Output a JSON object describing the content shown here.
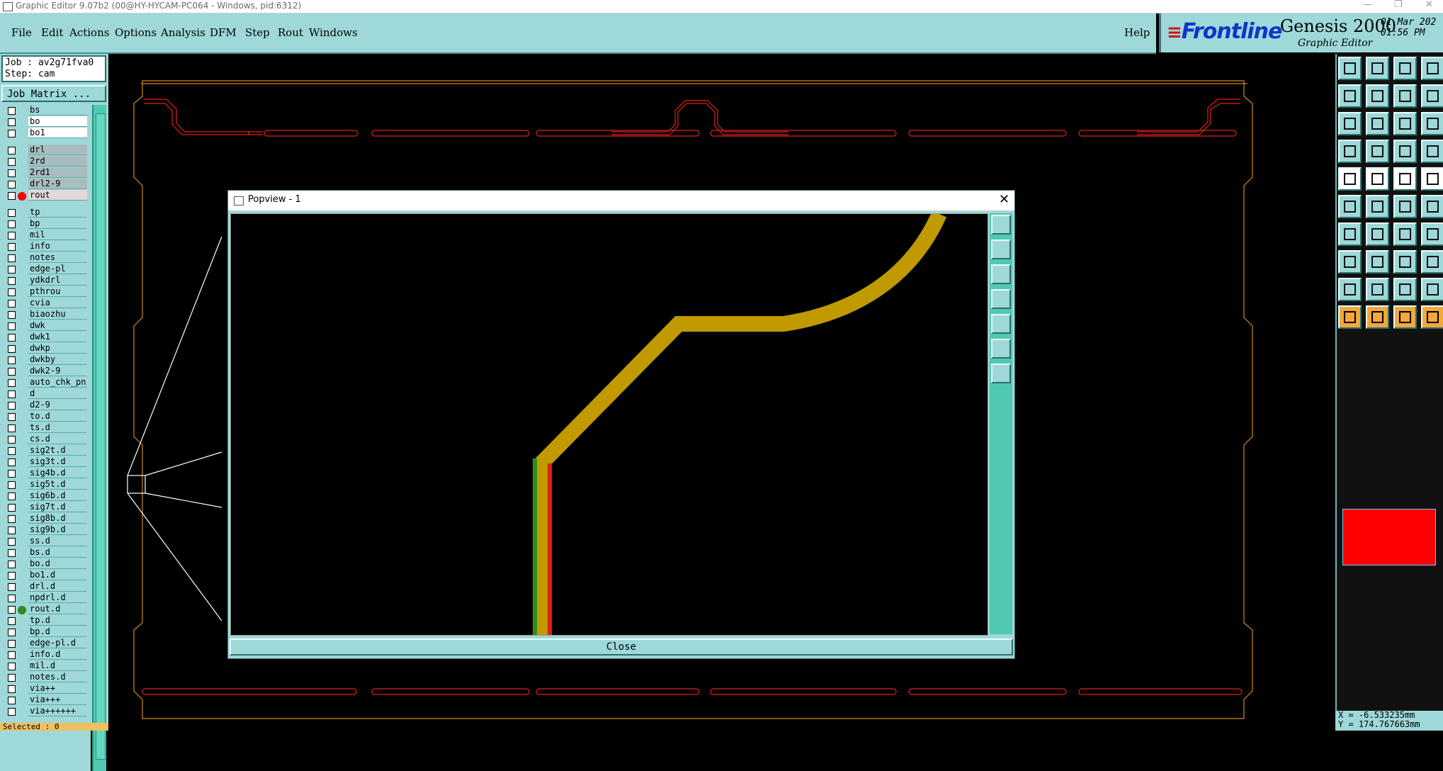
{
  "window": {
    "title": "Graphic Editor 9.07b2 (00@HY-HYCAM-PC064 - Windows, pid:6312)"
  },
  "menu": {
    "file": "File",
    "edit": "Edit",
    "actions": "Actions",
    "options": "Options",
    "analysis": "Analysis",
    "dfm": "DFM",
    "step": "Step",
    "rout": "Rout",
    "windows": "Windows",
    "help": "Help"
  },
  "brand": {
    "logo": "Frontline",
    "product": "Genesis 2000",
    "subtitle": "Graphic Editor",
    "date": "01 Mar 202",
    "time": "01:56 PM"
  },
  "job": {
    "job_line": "Job : av2g71fva0",
    "step_line": "Step: cam",
    "matrix_button": "Job Matrix ..."
  },
  "layers": [
    {
      "name": "bs",
      "style": "",
      "dot": ""
    },
    {
      "name": "bo",
      "style": "white",
      "dot": ""
    },
    {
      "name": "bo1",
      "style": "white",
      "dot": ""
    },
    {
      "name": "drl",
      "style": "drill",
      "dot": ""
    },
    {
      "name": "2rd",
      "style": "drill",
      "dot": ""
    },
    {
      "name": "2rd1",
      "style": "drill",
      "dot": ""
    },
    {
      "name": "drl2-9",
      "style": "drill",
      "dot": ""
    },
    {
      "name": "rout",
      "style": "rout",
      "dot": "#ff0000"
    },
    {
      "name": "tp",
      "style": "",
      "dot": ""
    },
    {
      "name": "bp",
      "style": "",
      "dot": ""
    },
    {
      "name": "mil",
      "style": "",
      "dot": ""
    },
    {
      "name": "info",
      "style": "",
      "dot": ""
    },
    {
      "name": "notes",
      "style": "",
      "dot": ""
    },
    {
      "name": "edge-pl",
      "style": "",
      "dot": ""
    },
    {
      "name": "ydkdrl",
      "style": "",
      "dot": ""
    },
    {
      "name": "pthrou",
      "style": "",
      "dot": ""
    },
    {
      "name": "cvia",
      "style": "",
      "dot": ""
    },
    {
      "name": "biaozhu",
      "style": "",
      "dot": ""
    },
    {
      "name": "dwk",
      "style": "",
      "dot": ""
    },
    {
      "name": "dwk1",
      "style": "",
      "dot": ""
    },
    {
      "name": "dwkp",
      "style": "",
      "dot": ""
    },
    {
      "name": "dwkby",
      "style": "",
      "dot": ""
    },
    {
      "name": "dwk2-9",
      "style": "",
      "dot": ""
    },
    {
      "name": "auto_chk_pn",
      "style": "",
      "dot": ""
    },
    {
      "name": "d",
      "style": "",
      "dot": ""
    },
    {
      "name": "d2-9",
      "style": "",
      "dot": ""
    },
    {
      "name": "to.d",
      "style": "",
      "dot": ""
    },
    {
      "name": "ts.d",
      "style": "",
      "dot": ""
    },
    {
      "name": "cs.d",
      "style": "",
      "dot": ""
    },
    {
      "name": "sig2t.d",
      "style": "",
      "dot": ""
    },
    {
      "name": "sig3t.d",
      "style": "",
      "dot": ""
    },
    {
      "name": "sig4b.d",
      "style": "",
      "dot": ""
    },
    {
      "name": "sig5t.d",
      "style": "",
      "dot": ""
    },
    {
      "name": "sig6b.d",
      "style": "",
      "dot": ""
    },
    {
      "name": "sig7t.d",
      "style": "",
      "dot": ""
    },
    {
      "name": "sig8b.d",
      "style": "",
      "dot": ""
    },
    {
      "name": "sig9b.d",
      "style": "",
      "dot": ""
    },
    {
      "name": "ss.d",
      "style": "",
      "dot": ""
    },
    {
      "name": "bs.d",
      "style": "",
      "dot": ""
    },
    {
      "name": "bo.d",
      "style": "",
      "dot": ""
    },
    {
      "name": "bo1.d",
      "style": "",
      "dot": ""
    },
    {
      "name": "drl.d",
      "style": "",
      "dot": ""
    },
    {
      "name": "npdrl.d",
      "style": "",
      "dot": ""
    },
    {
      "name": "rout.d",
      "style": "",
      "dot": "#2e8b1e"
    },
    {
      "name": "tp.d",
      "style": "",
      "dot": ""
    },
    {
      "name": "bp.d",
      "style": "",
      "dot": ""
    },
    {
      "name": "edge-pl.d",
      "style": "",
      "dot": ""
    },
    {
      "name": "info.d",
      "style": "",
      "dot": ""
    },
    {
      "name": "mil.d",
      "style": "",
      "dot": ""
    },
    {
      "name": "notes.d",
      "style": "",
      "dot": ""
    },
    {
      "name": "via++",
      "style": "",
      "dot": ""
    },
    {
      "name": "via+++",
      "style": "",
      "dot": ""
    },
    {
      "name": "via++++++",
      "style": "",
      "dot": ""
    }
  ],
  "status": {
    "selected": "Selected : 0"
  },
  "coords": {
    "x_line": "X = -6.533235mm",
    "y_line": "Y = 174.767663mm"
  },
  "popview": {
    "title": "Popview - 1",
    "close_label": "Close"
  },
  "colors": {
    "panel": "#9ed8d8",
    "rout_outline": "#e0201a",
    "profile": "#d08a1c",
    "trace": "#c09a00"
  }
}
